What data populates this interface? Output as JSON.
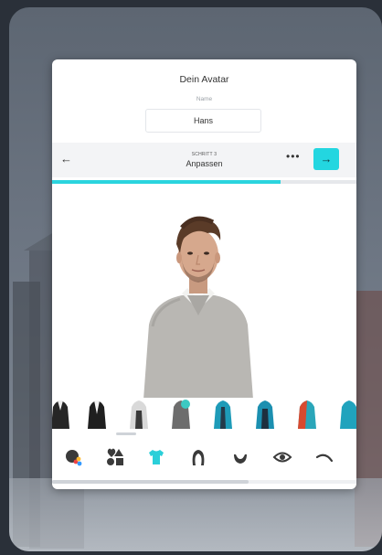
{
  "window": {
    "title": "Dein Avatar"
  },
  "name_section": {
    "label": "Name",
    "value": "Hans"
  },
  "step": {
    "small_label": "SCHRITT 3",
    "title": "Anpassen",
    "more_label": "•••",
    "back_glyph": "←",
    "next_glyph": "→"
  },
  "progress": {
    "fraction": 0.75
  },
  "colors": {
    "accent": "#23d6e0"
  },
  "clothes": [
    {
      "icon": "black-jacket-icon"
    },
    {
      "icon": "black-suit-icon"
    },
    {
      "icon": "white-shirt-icon"
    },
    {
      "icon": "grey-jacket-teal-icon"
    },
    {
      "icon": "teal-jacket-icon"
    },
    {
      "icon": "teal-jacket-dark-icon"
    },
    {
      "icon": "red-teal-jacket-icon"
    },
    {
      "icon": "teal-jacket-partial-icon"
    }
  ],
  "categories": [
    {
      "icon": "skin-color-icon"
    },
    {
      "icon": "shapes-icon"
    },
    {
      "icon": "shirt-icon",
      "active": true
    },
    {
      "icon": "hair-icon"
    },
    {
      "icon": "beard-icon"
    },
    {
      "icon": "eye-icon"
    },
    {
      "icon": "eyebrow-icon"
    }
  ]
}
